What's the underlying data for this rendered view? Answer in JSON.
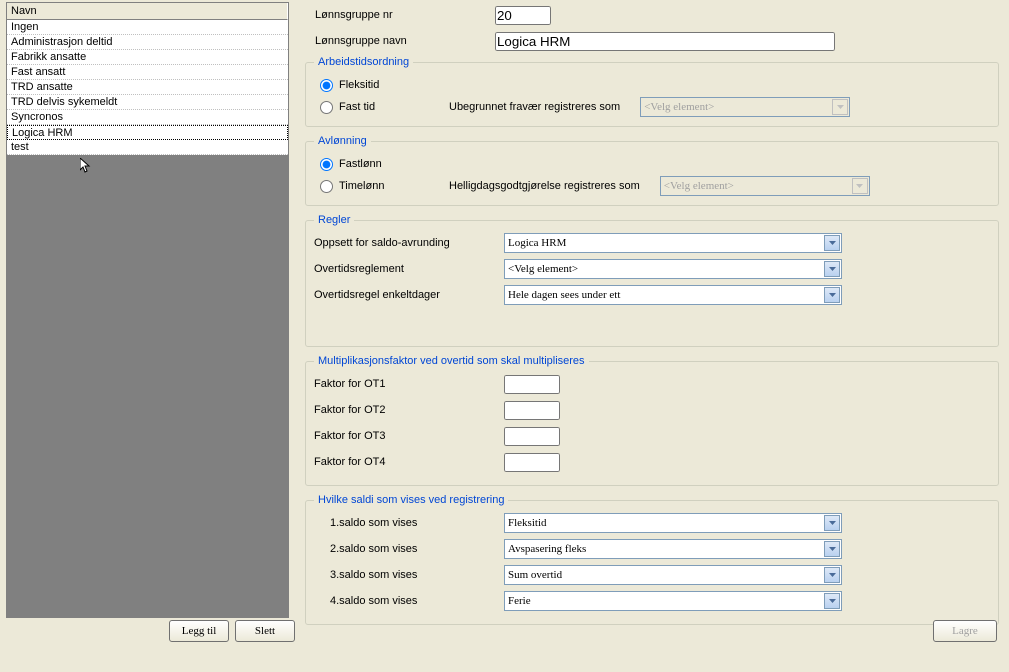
{
  "grid": {
    "header": "Navn",
    "rows": [
      "Ingen",
      "Administrasjon deltid",
      "Fabrikk ansatte",
      "Fast  ansatt",
      "TRD ansatte",
      "TRD delvis sykemeldt",
      "Syncronos",
      "Logica HRM",
      "test"
    ],
    "selected": "Logica HRM"
  },
  "top": {
    "lonnsgruppe_nr_label": "Lønnsgruppe nr",
    "lonnsgruppe_nr_value": "20",
    "lonnsgruppe_navn_label": "Lønnsgruppe navn",
    "lonnsgruppe_navn_value": "Logica HRM"
  },
  "arbeidstidsordning": {
    "legend": "Arbeidstidsordning",
    "fleksitid": "Fleksitid",
    "fast_tid": "Fast tid",
    "sub_label": "Ubegrunnet fravær registreres som",
    "sub_value": "<Velg element>"
  },
  "avlonning": {
    "legend": "Avlønning",
    "fastlonn": "Fastlønn",
    "timelonn": "Timelønn",
    "sub_label": "Helligdagsgodtgjørelse  registreres  som",
    "sub_value": "<Velg element>"
  },
  "regler": {
    "legend": "Regler",
    "oppsett_label": "Oppsett for saldo-avrunding",
    "oppsett_value": "Logica HRM",
    "overtid_label": "Overtidsreglement",
    "overtid_value": "<Velg element>",
    "enkeltdager_label": "Overtidsregel enkeltdager",
    "enkeltdager_value": "Hele dagen sees under ett"
  },
  "mult": {
    "legend": "Multiplikasjonsfaktor ved overtid som skal multipliseres",
    "f1_label": "Faktor for OT1",
    "f2_label": "Faktor for OT2",
    "f3_label": "Faktor for OT3",
    "f4_label": "Faktor for OT4",
    "f1_value": "",
    "f2_value": "",
    "f3_value": "",
    "f4_value": ""
  },
  "saldi": {
    "legend": "Hvilke saldi som vises ved registrering",
    "s1_label": "1.saldo som vises",
    "s1_value": "Fleksitid",
    "s2_label": "2.saldo som vises",
    "s2_value": "Avspasering fleks",
    "s3_label": "3.saldo som vises",
    "s3_value": "Sum overtid",
    "s4_label": "4.saldo som vises",
    "s4_value": "Ferie"
  },
  "buttons": {
    "legg_til": "Legg til",
    "slett": "Slett",
    "lagre": "Lagre"
  }
}
